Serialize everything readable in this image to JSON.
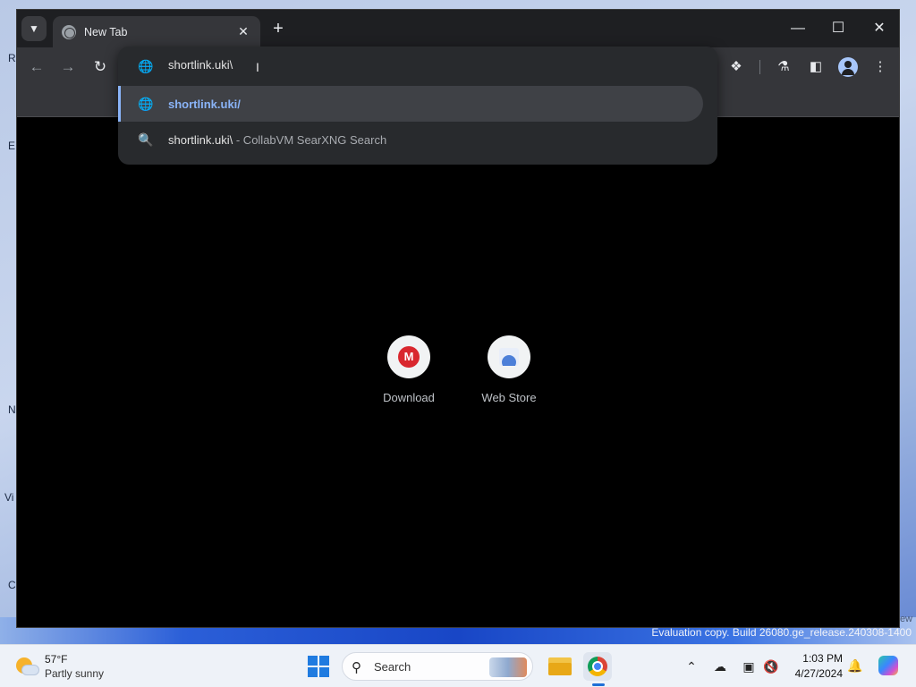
{
  "desktop": {
    "edge_letters": [
      "R",
      "E",
      "N",
      "Vi",
      "C"
    ],
    "watermark": "Evaluation copy. Build 26080.ge_release.240308-1400",
    "watermark_prefix": "ew"
  },
  "browser": {
    "tab": {
      "title": "New Tab"
    },
    "omnibox": {
      "value": "shortlink.uki\\",
      "suggestions": [
        {
          "text": "shortlink.uki/",
          "icon": "globe-icon",
          "selected": true
        },
        {
          "text": "shortlink.uki\\",
          "description": " - CollabVM SearXNG Search",
          "icon": "search-icon",
          "selected": false
        }
      ]
    },
    "shortcuts": [
      {
        "label": "Download",
        "icon": "mega-icon",
        "glyph": "M"
      },
      {
        "label": "Web Store",
        "icon": "web-store-icon"
      }
    ]
  },
  "taskbar": {
    "weather": {
      "temp": "57°F",
      "condition": "Partly sunny"
    },
    "search_label": "Search",
    "clock": {
      "time": "1:03 PM",
      "date": "4/27/2024"
    }
  }
}
